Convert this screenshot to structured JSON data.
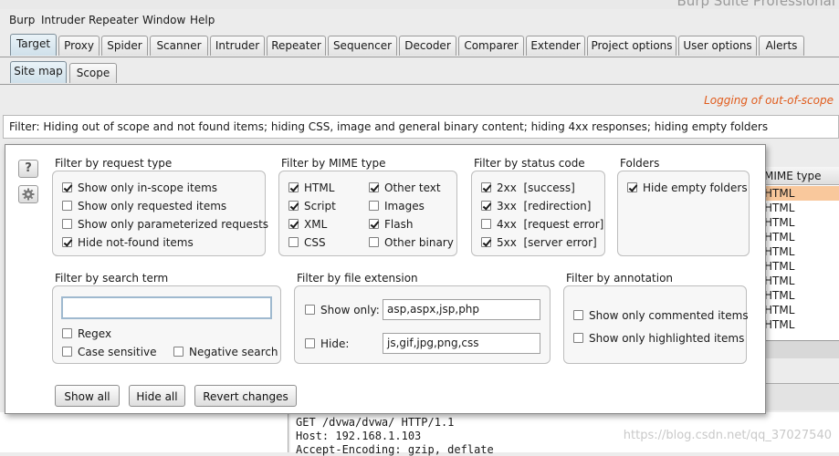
{
  "app": {
    "title": "Burp Suite Professional"
  },
  "menu": [
    "Burp",
    "Intruder",
    "Repeater",
    "Window",
    "Help"
  ],
  "main_tabs": [
    "Target",
    "Proxy",
    "Spider",
    "Scanner",
    "Intruder",
    "Repeater",
    "Sequencer",
    "Decoder",
    "Comparer",
    "Extender",
    "Project options",
    "User options",
    "Alerts"
  ],
  "sub_tabs": [
    "Site map",
    "Scope"
  ],
  "scope_note": "Logging of out-of-scope",
  "filter_summary": "Filter: Hiding out of scope and not found items;  hiding CSS, image and general binary content;  hiding 4xx responses;  hiding empty folders",
  "background_table": {
    "header": "MIME type",
    "rows": [
      "HTML",
      "HTML",
      "HTML",
      "HTML",
      "HTML",
      "HTML",
      "HTML",
      "HTML",
      "HTML",
      "HTML"
    ]
  },
  "request": {
    "lines": [
      "GET /dvwa/dvwa/ HTTP/1.1",
      "Host: 192.168.1.103",
      "Accept-Encoding: gzip, deflate"
    ]
  },
  "watermark": "https://blog.csdn.net/qq_37027540",
  "popup": {
    "side_buttons": {
      "help": "?"
    },
    "request_type": {
      "title": "Filter by request type",
      "options": [
        {
          "label": "Show only in-scope items",
          "checked": true
        },
        {
          "label": "Show only requested items",
          "checked": false
        },
        {
          "label": "Show only parameterized requests",
          "checked": false
        },
        {
          "label": "Hide not-found items",
          "checked": true
        }
      ]
    },
    "mime_type": {
      "title": "Filter by MIME type",
      "options": [
        {
          "label": "HTML",
          "checked": true
        },
        {
          "label": "Other text",
          "checked": true
        },
        {
          "label": "Script",
          "checked": true
        },
        {
          "label": "Images",
          "checked": false
        },
        {
          "label": "XML",
          "checked": true
        },
        {
          "label": "Flash",
          "checked": true
        },
        {
          "label": "CSS",
          "checked": false
        },
        {
          "label": "Other binary",
          "checked": false
        }
      ]
    },
    "status_code": {
      "title": "Filter by status code",
      "options": [
        {
          "label": "2xx  [success]",
          "checked": true
        },
        {
          "label": "3xx  [redirection]",
          "checked": true
        },
        {
          "label": "4xx  [request error]",
          "checked": false
        },
        {
          "label": "5xx  [server error]",
          "checked": true
        }
      ]
    },
    "folders": {
      "title": "Folders",
      "options": [
        {
          "label": "Hide empty folders",
          "checked": true
        }
      ]
    },
    "search_term": {
      "title": "Filter by search term",
      "value": "",
      "options": [
        {
          "label": "Regex",
          "checked": false
        },
        {
          "label": "Case sensitive",
          "checked": false
        },
        {
          "label": "Negative search",
          "checked": false
        }
      ]
    },
    "file_extension": {
      "title": "Filter by file extension",
      "show_only": {
        "label": "Show only:",
        "checked": false,
        "value": "asp,aspx,jsp,php"
      },
      "hide": {
        "label": "Hide:",
        "checked": false,
        "value": "js,gif,jpg,png,css"
      }
    },
    "annotation": {
      "title": "Filter by annotation",
      "options": [
        {
          "label": "Show only commented items",
          "checked": false
        },
        {
          "label": "Show only highlighted items",
          "checked": false
        }
      ]
    },
    "buttons": {
      "show_all": "Show all",
      "hide_all": "Hide all",
      "revert": "Revert changes"
    }
  }
}
